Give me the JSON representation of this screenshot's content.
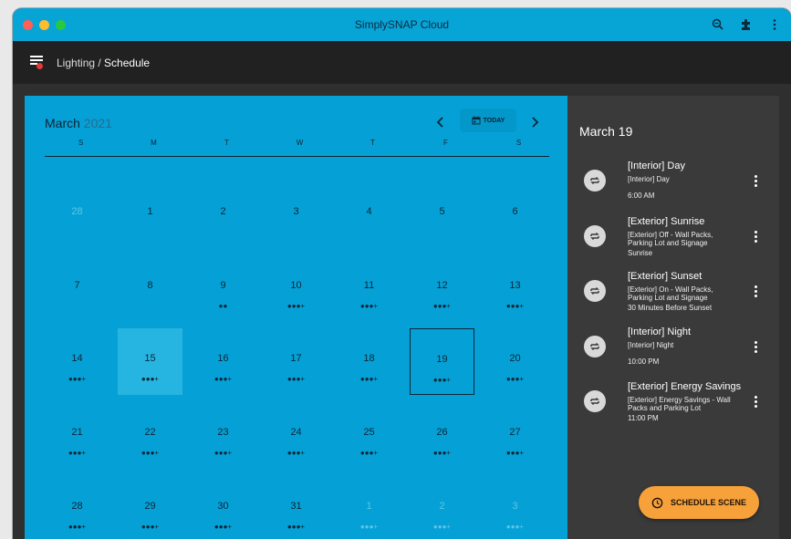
{
  "window": {
    "title": "SimplySNAP Cloud",
    "icons": [
      "zoom-icon",
      "extension-icon",
      "more-vert-icon"
    ]
  },
  "toolbar": {
    "menu_icon": "menu-with-alert-icon",
    "breadcrumb_parent": "Lighting / ",
    "breadcrumb_current": "Schedule"
  },
  "calendar": {
    "month": "March",
    "year": "2021",
    "today_label": "TODAY",
    "days_of_week": [
      "S",
      "M",
      "T",
      "W",
      "T",
      "F",
      "S"
    ],
    "weeks": [
      [
        {
          "d": "28",
          "out": true,
          "dots": ""
        },
        {
          "d": "1",
          "dots": ""
        },
        {
          "d": "2",
          "dots": ""
        },
        {
          "d": "3",
          "dots": ""
        },
        {
          "d": "4",
          "dots": ""
        },
        {
          "d": "5",
          "dots": ""
        },
        {
          "d": "6",
          "dots": ""
        }
      ],
      [
        {
          "d": "7",
          "dots": ""
        },
        {
          "d": "8",
          "dots": ""
        },
        {
          "d": "9",
          "dots": "●●"
        },
        {
          "d": "10",
          "dots": "●●●+"
        },
        {
          "d": "11",
          "dots": "●●●+"
        },
        {
          "d": "12",
          "dots": "●●●+"
        },
        {
          "d": "13",
          "dots": "●●●+"
        }
      ],
      [
        {
          "d": "14",
          "dots": "●●●+"
        },
        {
          "d": "15",
          "dots": "●●●+",
          "selected": true
        },
        {
          "d": "16",
          "dots": "●●●+"
        },
        {
          "d": "17",
          "dots": "●●●+"
        },
        {
          "d": "18",
          "dots": "●●●+"
        },
        {
          "d": "19",
          "dots": "●●●+",
          "focused": true
        },
        {
          "d": "20",
          "dots": "●●●+"
        }
      ],
      [
        {
          "d": "21",
          "dots": "●●●+"
        },
        {
          "d": "22",
          "dots": "●●●+"
        },
        {
          "d": "23",
          "dots": "●●●+"
        },
        {
          "d": "24",
          "dots": "●●●+"
        },
        {
          "d": "25",
          "dots": "●●●+"
        },
        {
          "d": "26",
          "dots": "●●●+"
        },
        {
          "d": "27",
          "dots": "●●●+"
        }
      ],
      [
        {
          "d": "28",
          "dots": "●●●+"
        },
        {
          "d": "29",
          "dots": "●●●+"
        },
        {
          "d": "30",
          "dots": "●●●+"
        },
        {
          "d": "31",
          "dots": "●●●+"
        },
        {
          "d": "1",
          "out": true,
          "dots": "●●●+"
        },
        {
          "d": "2",
          "out": true,
          "dots": "●●●+"
        },
        {
          "d": "3",
          "out": true,
          "dots": "●●●+"
        }
      ]
    ]
  },
  "side_panel": {
    "date": "March 19",
    "events": [
      {
        "title": "[Interior] Day",
        "lines": [
          "[Interior] Day"
        ],
        "time": "6:00 AM"
      },
      {
        "title": "[Exterior] Sunrise",
        "lines": [
          "[Exterior] Off - Wall Packs,",
          "Parking Lot and Signage"
        ],
        "time": "Sunrise"
      },
      {
        "title": "[Exterior] Sunset",
        "lines": [
          "[Exterior] On - Wall Packs,",
          "Parking Lot and Signage"
        ],
        "time": "30 Minutes Before Sunset"
      },
      {
        "title": "[Interior] Night",
        "lines": [
          "[Interior] Night"
        ],
        "time": "10:00 PM"
      },
      {
        "title": "[Exterior] Energy Savings",
        "lines": [
          "[Exterior] Energy Savings - Wall",
          "Packs and Parking Lot"
        ],
        "time": "11:00 PM"
      }
    ]
  },
  "fab": {
    "label": "SCHEDULE SCENE",
    "icon": "clock-icon"
  },
  "colors": {
    "titlebar": "#07a4d6",
    "calendar": "#05a1d6",
    "accent": "#f6a13a"
  }
}
